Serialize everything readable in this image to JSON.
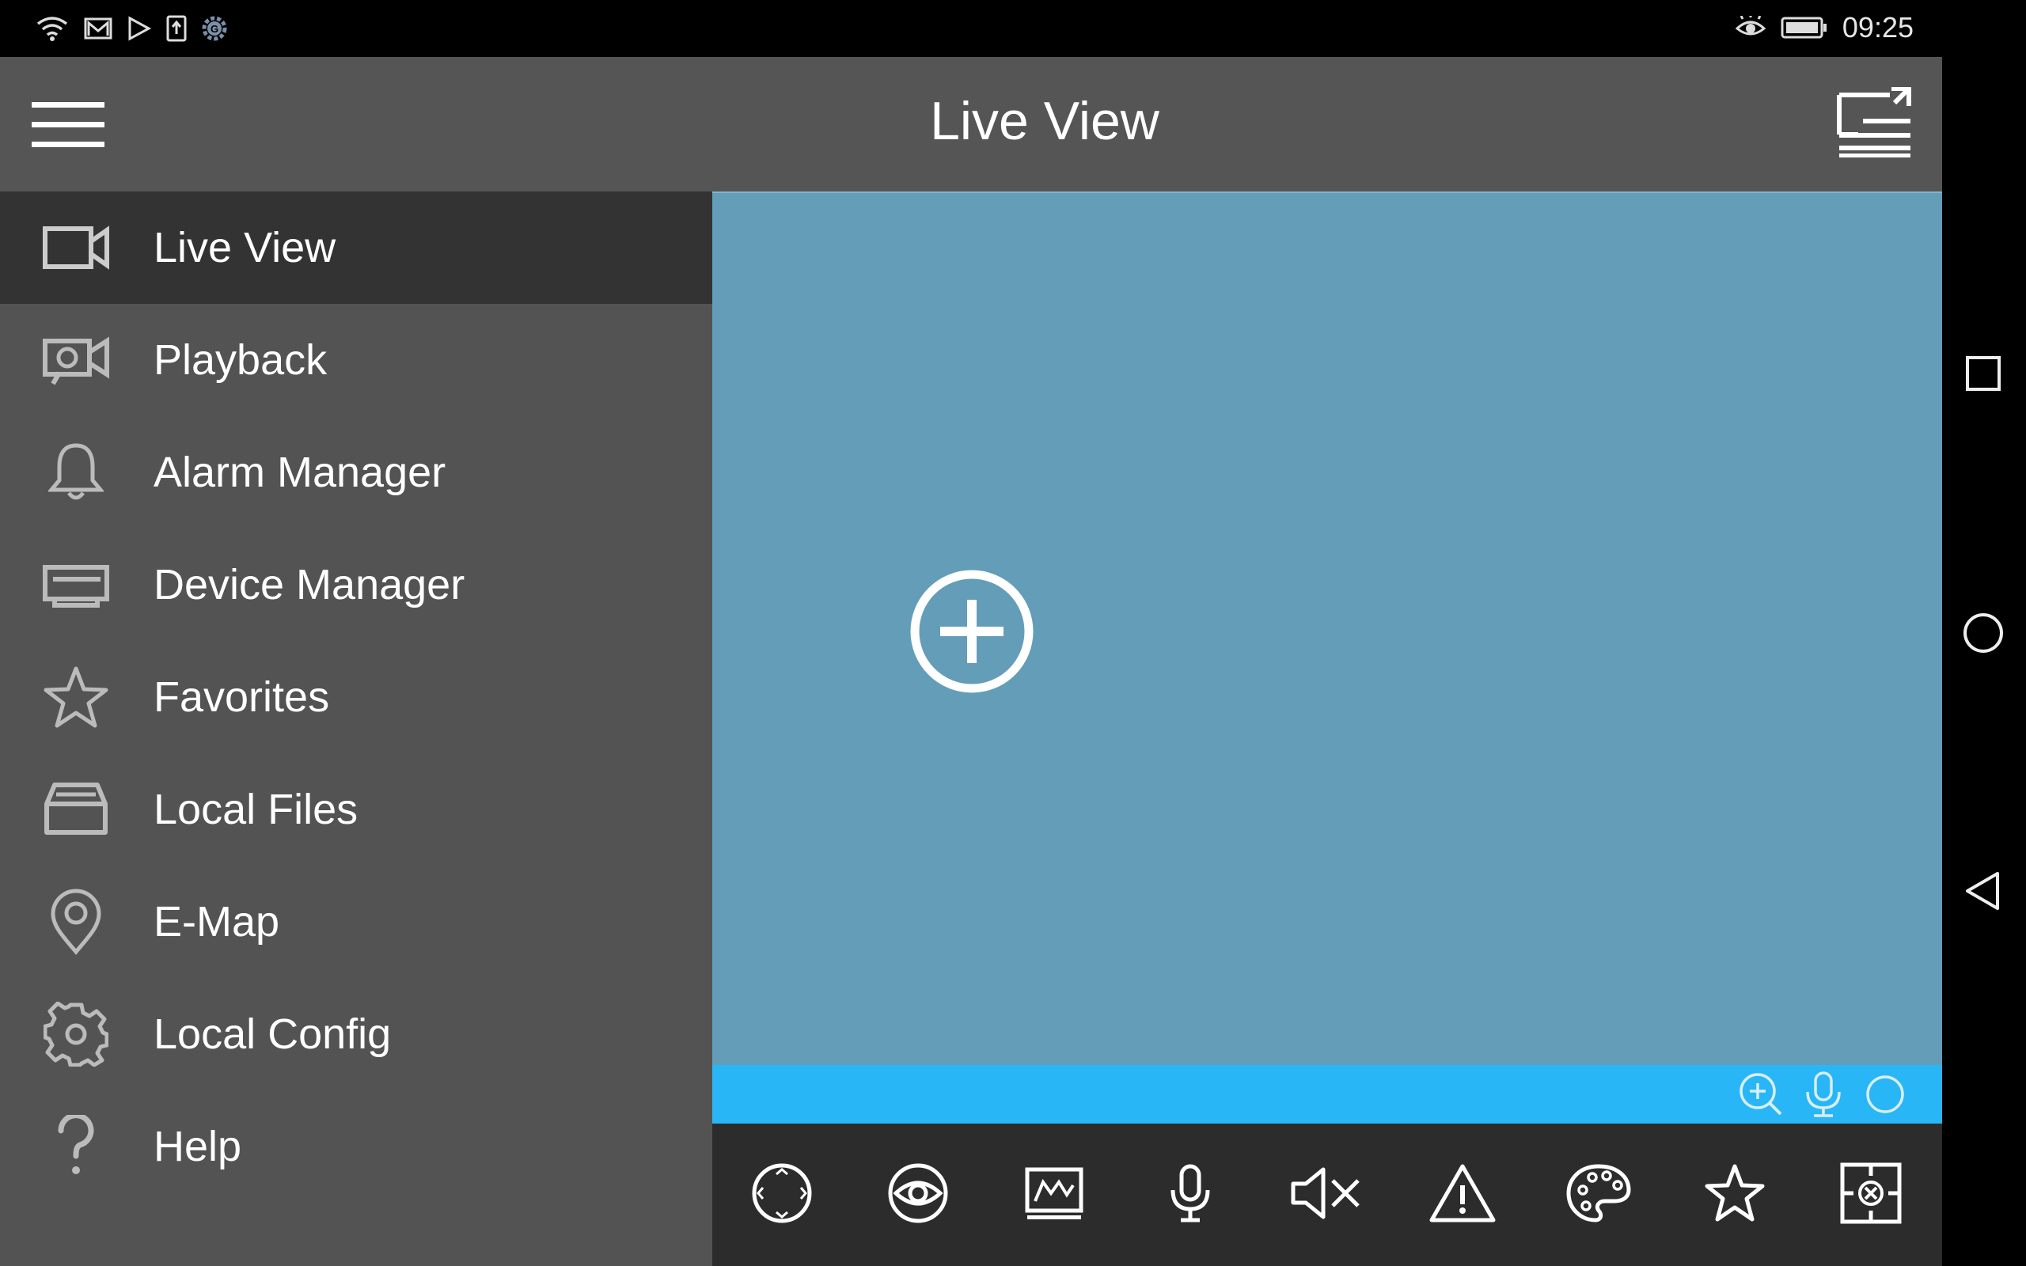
{
  "status_bar": {
    "time": "09:25",
    "left_icons": [
      "wifi-icon",
      "mail-icon",
      "play-store-icon",
      "upload-icon",
      "settings-g-icon"
    ],
    "right_icons": [
      "eye-icon",
      "battery-icon"
    ]
  },
  "header": {
    "title": "Live View",
    "menu_icon": "hamburger-icon",
    "layout_icon": "window-layout-icon"
  },
  "sidebar": {
    "items": [
      {
        "label": "Live View",
        "icon": "video-camera-icon",
        "active": true
      },
      {
        "label": "Playback",
        "icon": "playback-camera-icon",
        "active": false
      },
      {
        "label": "Alarm Manager",
        "icon": "bell-icon",
        "active": false
      },
      {
        "label": "Device Manager",
        "icon": "dvr-device-icon",
        "active": false
      },
      {
        "label": "Favorites",
        "icon": "star-icon",
        "active": false
      },
      {
        "label": "Local Files",
        "icon": "folder-tray-icon",
        "active": false
      },
      {
        "label": "E-Map",
        "icon": "map-pin-icon",
        "active": false
      },
      {
        "label": "Local Config",
        "icon": "gear-icon",
        "active": false
      },
      {
        "label": "Help",
        "icon": "question-icon",
        "active": false
      }
    ]
  },
  "video_panel": {
    "add_icon": "add-circle-icon",
    "bar_icons": [
      "zoom-in-icon",
      "microphone-icon",
      "record-circle-icon"
    ]
  },
  "toolbar": {
    "icons": [
      "ptz-icon",
      "eye-view-icon",
      "image-adjust-icon",
      "microphone-icon",
      "mute-icon",
      "alarm-warning-icon",
      "palette-icon",
      "favorite-star-icon",
      "close-channel-icon"
    ]
  },
  "system_nav": [
    "square-icon",
    "circle-icon",
    "back-triangle-icon"
  ],
  "colors": {
    "app_background": "#555555",
    "sidebar_active": "#333333",
    "video_background": "#649db8",
    "video_bar": "#29b6f6",
    "toolbar": "#2c2c2c"
  }
}
